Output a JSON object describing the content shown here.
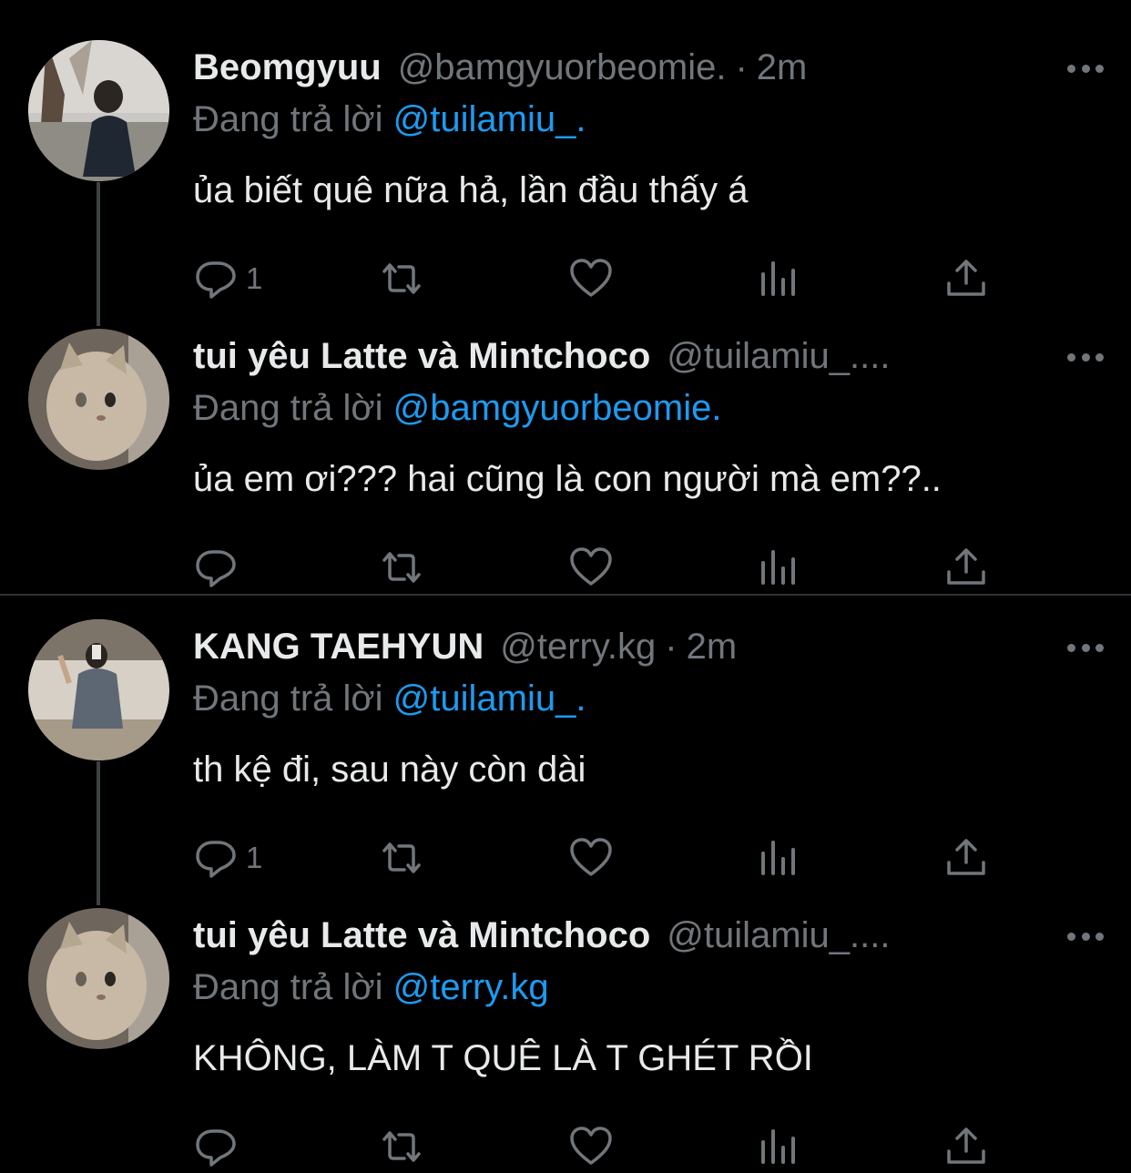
{
  "tweets": [
    {
      "display_name": "Beomgyuu",
      "handle": "@bamgyuorbeomie.",
      "time": "2m",
      "reply_prefix": "Đang trả lời",
      "reply_to": "@tuilamiu_.",
      "text": "ủa biết quê nữa hả, lần đầu thấy á",
      "reply_count": "1",
      "avatar_icon": "person-photo-avatar"
    },
    {
      "display_name": "tui yêu Latte và Mintchoco",
      "handle": "@tuilamiu_....",
      "time": "",
      "reply_prefix": "Đang trả lời",
      "reply_to": "@bamgyuorbeomie.",
      "text": "ủa em ơi??? hai cũng là con người mà em??..",
      "reply_count": "",
      "avatar_icon": "cat-photo-avatar"
    },
    {
      "display_name": "KANG TAEHYUN",
      "handle": "@terry.kg",
      "time": "2m",
      "reply_prefix": "Đang trả lời",
      "reply_to": "@tuilamiu_.",
      "text": "th kệ đi, sau này còn dài",
      "reply_count": "1",
      "avatar_icon": "person-selfie-avatar"
    },
    {
      "display_name": "tui yêu Latte và Mintchoco",
      "handle": "@tuilamiu_....",
      "time": "",
      "reply_prefix": "Đang trả lời",
      "reply_to": "@terry.kg",
      "text": "KHÔNG, LÀM T QUÊ LÀ T GHÉT RỒI",
      "reply_count": "",
      "avatar_icon": "cat-photo-avatar"
    }
  ],
  "separator": "·",
  "colors": {
    "background": "#000000",
    "primary_text": "#e7e9ea",
    "secondary_text": "#71767b",
    "accent": "#1d9bf0",
    "thread_line": "#3d4144",
    "divider": "#2f3336"
  }
}
